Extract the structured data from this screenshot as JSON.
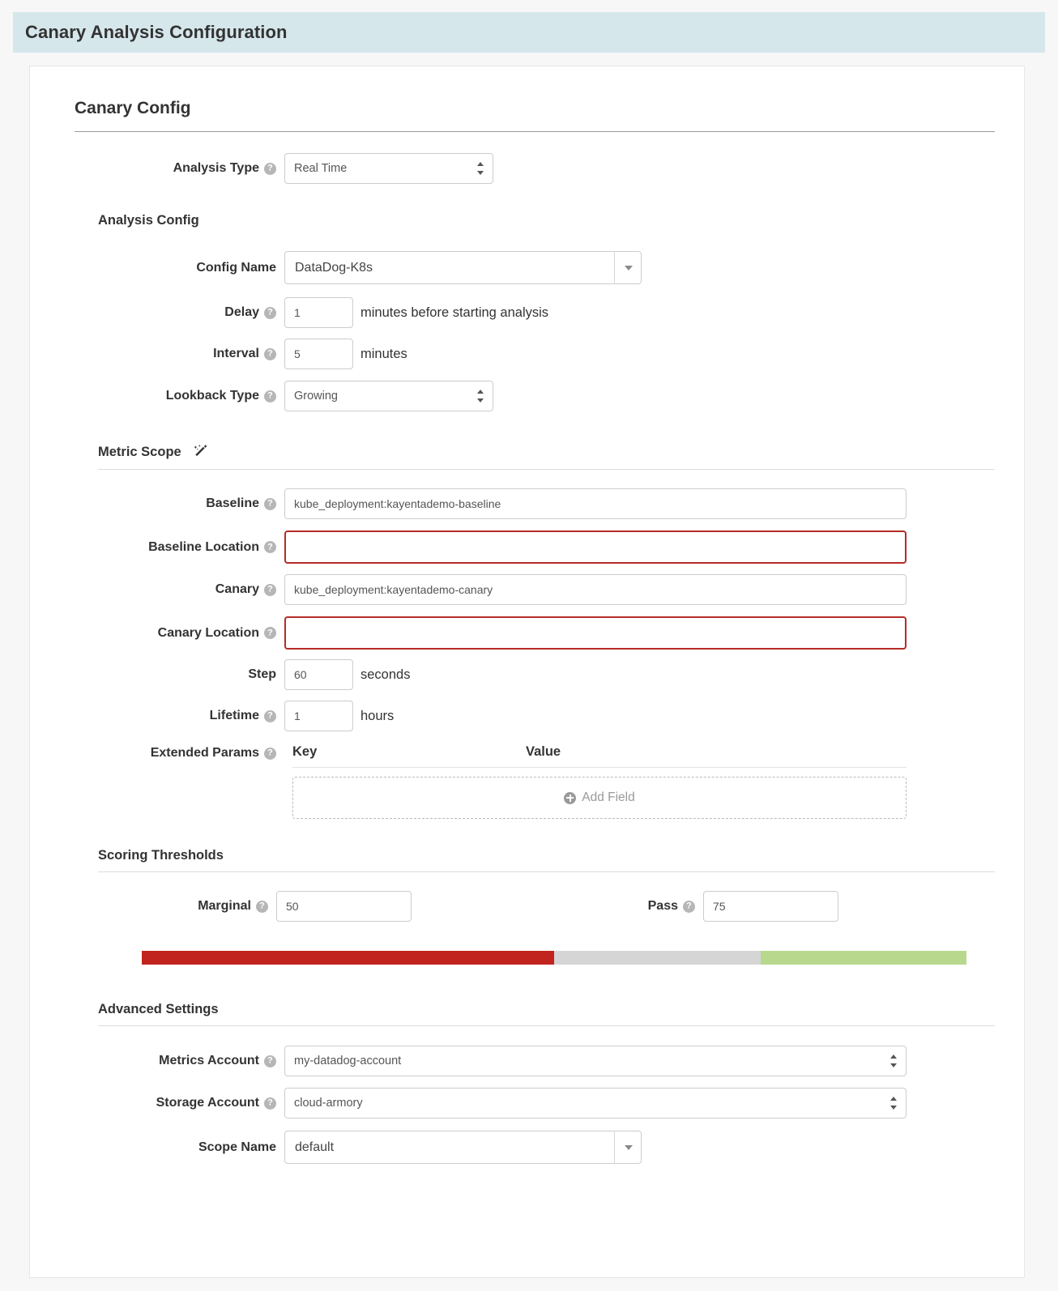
{
  "header": {
    "title": "Canary Analysis Configuration",
    "band_color": "#d6e7ec"
  },
  "card": {
    "heading": "Canary Config"
  },
  "analysis_type": {
    "label": "Analysis Type",
    "help_icon": "help-circle-icon",
    "value": "Real Time",
    "options": [
      "Real Time"
    ]
  },
  "analysis_config": {
    "section_title": "Analysis Config",
    "config_name": {
      "label": "Config Name",
      "value": "DataDog-K8s",
      "caret_icon": "chevron-down-icon"
    },
    "delay": {
      "label": "Delay",
      "help_icon": "help-circle-icon",
      "value": "1",
      "unit": "minutes before starting analysis"
    },
    "interval": {
      "label": "Interval",
      "help_icon": "help-circle-icon",
      "value": "5",
      "unit": "minutes"
    },
    "lookback_type": {
      "label": "Lookback Type",
      "help_icon": "help-circle-icon",
      "value": "Growing",
      "options": [
        "Growing"
      ]
    }
  },
  "metric_scope": {
    "section_title": "Metric Scope",
    "wand_icon": "magic-wand-icon",
    "baseline": {
      "label": "Baseline",
      "help_icon": "help-circle-icon",
      "value": "kube_deployment:kayentademo-baseline"
    },
    "baseline_location": {
      "label": "Baseline Location",
      "help_icon": "help-circle-icon",
      "value": "",
      "error": true
    },
    "canary": {
      "label": "Canary",
      "help_icon": "help-circle-icon",
      "value": "kube_deployment:kayentademo-canary"
    },
    "canary_location": {
      "label": "Canary Location",
      "help_icon": "help-circle-icon",
      "value": "",
      "error": true
    },
    "step": {
      "label": "Step",
      "value": "60",
      "unit": "seconds"
    },
    "lifetime": {
      "label": "Lifetime",
      "help_icon": "help-circle-icon",
      "value": "1",
      "unit": "hours"
    },
    "extended_params": {
      "label": "Extended Params",
      "help_icon": "help-circle-icon",
      "columns": [
        "Key",
        "Value"
      ],
      "rows": [],
      "add_label": "Add Field",
      "add_icon": "plus-circle-icon"
    }
  },
  "scoring_thresholds": {
    "section_title": "Scoring Thresholds",
    "marginal": {
      "label": "Marginal",
      "help_icon": "help-circle-icon",
      "value": "50"
    },
    "pass": {
      "label": "Pass",
      "help_icon": "help-circle-icon",
      "value": "75"
    },
    "bar": {
      "fail_color": "#c1241f",
      "marginal_color": "#d5d5d5",
      "pass_color": "#b8d98d",
      "fail_pct": "50",
      "marginal_pct": "25",
      "pass_pct": "25"
    }
  },
  "advanced_settings": {
    "section_title": "Advanced Settings",
    "metrics_account": {
      "label": "Metrics Account",
      "help_icon": "help-circle-icon",
      "value": "my-datadog-account",
      "options": [
        "my-datadog-account"
      ]
    },
    "storage_account": {
      "label": "Storage Account",
      "help_icon": "help-circle-icon",
      "value": "cloud-armory",
      "options": [
        "cloud-armory"
      ]
    },
    "scope_name": {
      "label": "Scope Name",
      "value": "default",
      "caret_icon": "chevron-down-icon"
    }
  }
}
